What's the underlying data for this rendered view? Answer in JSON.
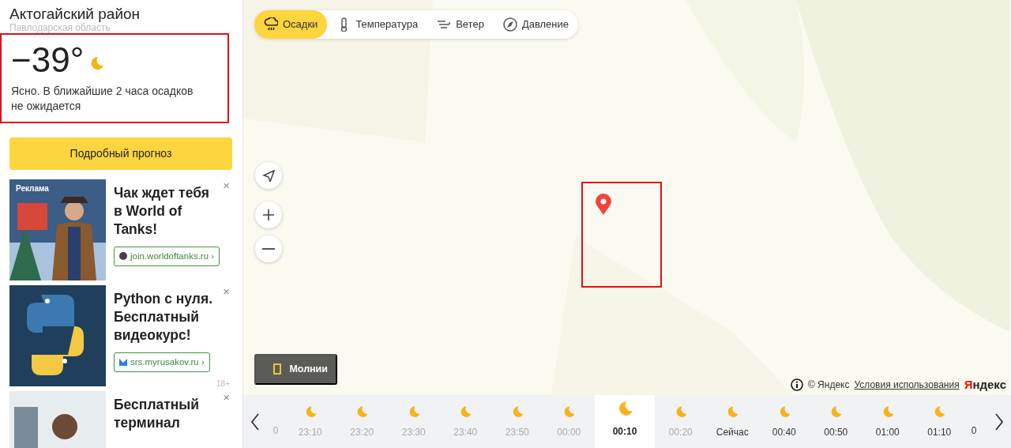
{
  "location": {
    "title": "Актогайский район",
    "region": "Павлодарская область"
  },
  "current": {
    "temperature": "−39°",
    "description": "Ясно. В ближайшие 2 часа осадков не ожидается",
    "highlighted": true
  },
  "forecast_button": "Подробный прогноз",
  "ads": [
    {
      "label": "Реклама",
      "title": "Чак ждет тебя в World of Tanks!",
      "link": "join.worldoftanks.ru ›",
      "close": "×"
    },
    {
      "title": "Python с нуля. Бесплатный видеокурс!",
      "link": "srs.myrusakov.ru ›",
      "age": "18+",
      "close": "×"
    },
    {
      "title": "Бесплатный терминал",
      "close": "×"
    }
  ],
  "map": {
    "layers": [
      {
        "label": "Осадки",
        "selected": true
      },
      {
        "label": "Температура",
        "selected": false
      },
      {
        "label": "Ветер",
        "selected": false
      },
      {
        "label": "Давление",
        "selected": false
      }
    ],
    "lightning": {
      "label": "Молнии",
      "checked": false
    },
    "area_highlighted": true,
    "attribution": {
      "copyright": "© Яндекс",
      "terms": "Условия использования",
      "logo": "Яндекс"
    }
  },
  "timeline": [
    {
      "time": "0",
      "kind": "past",
      "selected": false
    },
    {
      "time": "23:10",
      "kind": "past",
      "selected": false
    },
    {
      "time": "23:20",
      "kind": "past",
      "selected": false
    },
    {
      "time": "23:30",
      "kind": "past",
      "selected": false
    },
    {
      "time": "23:40",
      "kind": "past",
      "selected": false
    },
    {
      "time": "23:50",
      "kind": "past",
      "selected": false
    },
    {
      "time": "00:00",
      "kind": "past",
      "selected": false
    },
    {
      "time": "00:10",
      "kind": "past",
      "selected": true
    },
    {
      "time": "00:20",
      "kind": "past",
      "selected": false
    },
    {
      "time": "Сейчас",
      "kind": "now",
      "selected": false
    },
    {
      "time": "00:40",
      "kind": "future",
      "selected": false
    },
    {
      "time": "00:50",
      "kind": "future",
      "selected": false
    },
    {
      "time": "01:00",
      "kind": "future",
      "selected": false
    },
    {
      "time": "01:10",
      "kind": "future",
      "selected": false
    },
    {
      "time": "0",
      "kind": "future",
      "selected": false
    }
  ]
}
